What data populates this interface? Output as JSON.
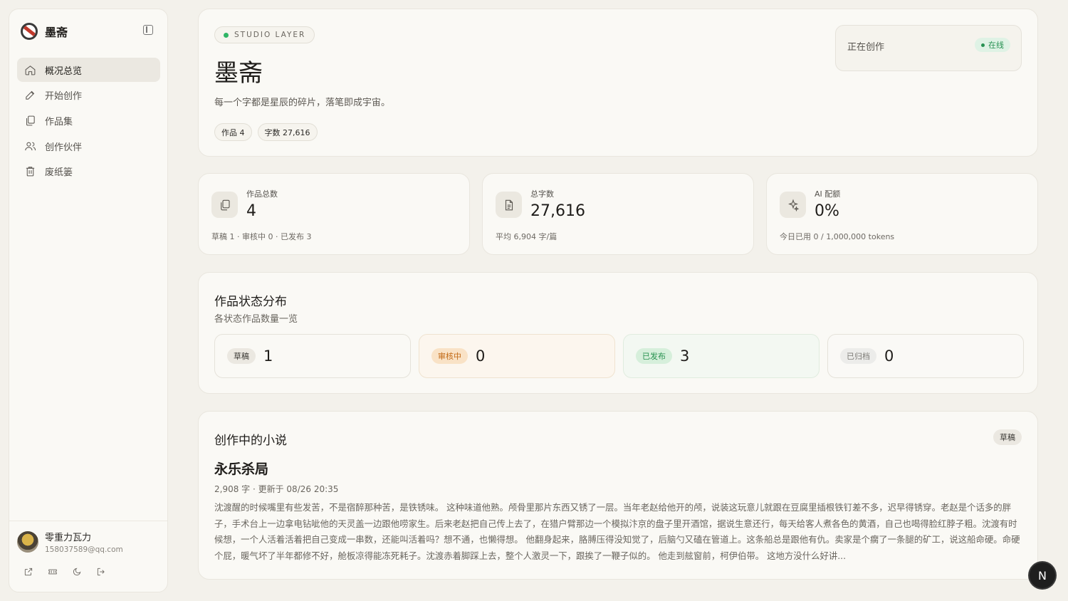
{
  "app": {
    "brand": "墨斋"
  },
  "sidebar": {
    "items": [
      {
        "label": "概况总览",
        "icon": "home-icon",
        "active": true
      },
      {
        "label": "开始创作",
        "icon": "pen-icon",
        "active": false
      },
      {
        "label": "作品集",
        "icon": "copy-icon",
        "active": false
      },
      {
        "label": "创作伙伴",
        "icon": "users-icon",
        "active": false
      },
      {
        "label": "废纸篓",
        "icon": "trash-icon",
        "active": false
      }
    ],
    "user": {
      "name": "零重力瓦力",
      "email": "158037589@qq.com"
    }
  },
  "hero": {
    "tag": "STUDIO LAYER",
    "title": "墨斋",
    "subtitle": "每一个字都是星辰的碎片，落笔即成宇宙。",
    "chips": [
      "作品 4",
      "字数 27,616"
    ],
    "now_label": "正在创作",
    "status": "在线"
  },
  "stats": [
    {
      "label": "作品总数",
      "value": "4",
      "note": "草稿 1 · 审核中 0 · 已发布 3",
      "icon": "copy-icon"
    },
    {
      "label": "总字数",
      "value": "27,616",
      "note": "平均 6,904 字/篇",
      "icon": "document-icon"
    },
    {
      "label": "AI 配额",
      "value": "0%",
      "note": "今日已用 0 / 1,000,000 tokens",
      "icon": "sparkle-icon"
    }
  ],
  "distribution": {
    "title": "作品状态分布",
    "subtitle": "各状态作品数量一览",
    "items": [
      {
        "label": "草稿",
        "count": "1"
      },
      {
        "label": "审核中",
        "count": "0"
      },
      {
        "label": "已发布",
        "count": "3"
      },
      {
        "label": "已归档",
        "count": "0"
      }
    ]
  },
  "novel": {
    "section_title": "创作中的小说",
    "badge": "草稿",
    "title": "永乐杀局",
    "meta": "2,908 字 · 更新于 08/26 20:35",
    "excerpt": "沈渡醒的时候嘴里有些发苦，不是宿醉那种苦，是铁锈味。 这种味道他熟。颅骨里那片东西又锈了一层。当年老赵给他开的颅，说装这玩意儿就跟在豆腐里插根铁钉差不多，迟早得锈穿。老赵是个话多的胖子，手术台上一边拿电钻呲他的天灵盖一边跟他唠家生。后来老赵把自己传上去了，在猎户臂那边一个模拟汴京的盘子里开酒馆，据说生意还行，每天给客人煮各色的黄酒，自己也喝得脸红脖子粗。沈渡有时候想，一个人活着活着把自己变成一串数，还能叫活着吗？想不通，也懒得想。 他翻身起来，胳膊压得没知觉了，后脑勺又磕在管道上。这条船总是跟他有仇。卖家是个瘸了一条腿的矿工，说这船命硬。命硬个屁，暖气坏了半年都修不好，舱板凉得能冻死耗子。沈渡赤着脚踩上去，整个人激灵一下，跟挨了一鞭子似的。 他走到舷窗前，柯伊伯带。 这地方没什么好讲..."
  },
  "fab": {
    "label": "N"
  }
}
